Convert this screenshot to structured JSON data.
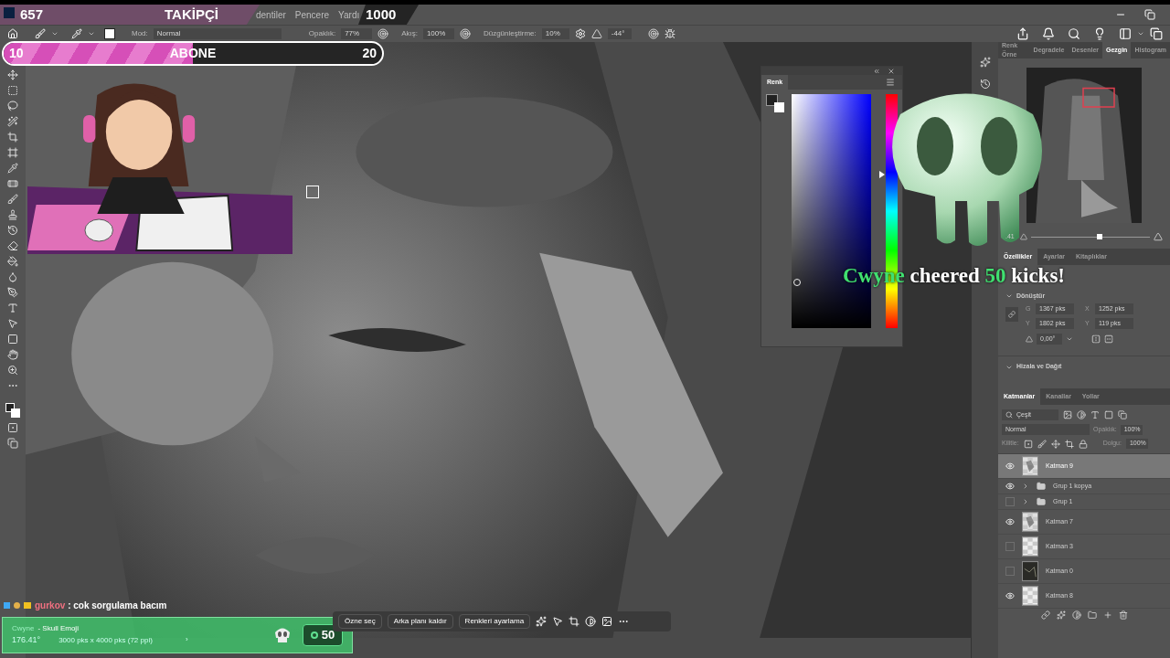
{
  "overlay_followers": {
    "count": "657",
    "label": "TAKİPÇİ",
    "goal": "1000"
  },
  "menu": [
    "dentiler",
    "Pencere",
    "Yardı"
  ],
  "options_bar": {
    "mode_label": "Mod:",
    "mode": "Normal",
    "opacity_label": "Opaklık:",
    "opacity": "77%",
    "flow_label": "Akış:",
    "flow": "100%",
    "smoothing_label": "Düzgünleştirme:",
    "smoothing": "10%",
    "angle": "-44°"
  },
  "overlay_subscribers": {
    "count": "10",
    "label": "ABONE",
    "goal": "20",
    "level": 0.5
  },
  "color_panel": {
    "tab": "Renk",
    "hue": {
      "level": 0.67
    }
  },
  "cheer": {
    "user": "Cwyne",
    "verb": "cheered",
    "amount": "50",
    "rest": "kicks!"
  },
  "top_tabs": [
    {
      "label": "Renk Örne",
      "selected": false
    },
    {
      "label": "Degradele",
      "selected": false
    },
    {
      "label": "Desenler",
      "selected": false
    },
    {
      "label": "Gezgin",
      "selected": true
    },
    {
      "label": "Histogram",
      "selected": false
    }
  ],
  "navigator": {
    "zoom_partial": ".41",
    "zoom_slider": {
      "level": 0.55
    }
  },
  "properties_tabs": [
    {
      "label": "Özellikler",
      "selected": true
    },
    {
      "label": "Ayarlar",
      "selected": false
    },
    {
      "label": "Kitaplıklar",
      "selected": false
    }
  ],
  "transform": {
    "title": "Dönüştür",
    "fields": [
      {
        "label": "G",
        "value": "1367 pks"
      },
      {
        "label": "X",
        "value": "1252 pks"
      },
      {
        "label": "Y",
        "value": "1802 pks"
      },
      {
        "label": "Y",
        "value": "119 pks"
      }
    ],
    "angle": "0,00°"
  },
  "align_section": "Hizala ve Dağıt",
  "layer_tabs": [
    {
      "label": "Katmanlar",
      "selected": true
    },
    {
      "label": "Kanallar",
      "selected": false
    },
    {
      "label": "Yollar",
      "selected": false
    }
  ],
  "layer_controls": {
    "filter": "Çeşit",
    "blend": "Normal",
    "opacity_label": "Opaklık:",
    "opacity": "100%",
    "lock_label": "Kilitle:",
    "fill_label": "Dolgu:",
    "fill": "100%"
  },
  "layers": [
    {
      "name": "Katman 9",
      "kind": "layer",
      "thumbnail": {
        "kind": "sketch"
      },
      "visible": true,
      "selected": true
    },
    {
      "name": "Grup 1 kopya",
      "kind": "group",
      "visible": true,
      "selected": false
    },
    {
      "name": "Grup 1",
      "kind": "group",
      "visible": false,
      "selected": false
    },
    {
      "name": "Katman 7",
      "kind": "layer",
      "thumbnail": {
        "kind": "sketch"
      },
      "visible": true,
      "selected": false
    },
    {
      "name": "Katman 3",
      "kind": "layer",
      "thumbnail": {
        "kind": "transparent"
      },
      "visible": false,
      "selected": false
    },
    {
      "name": "Katman 0",
      "kind": "layer",
      "thumbnail": {
        "kind": "dark"
      },
      "visible": false,
      "selected": false
    },
    {
      "name": "Katman 8",
      "kind": "layer",
      "thumbnail": {
        "kind": "transparent"
      },
      "visible": true,
      "selected": false
    }
  ],
  "chat": {
    "user": "gurkov",
    "message": ": cok sorgulama bacım"
  },
  "alert": {
    "user": "Cwyne",
    "item": "- Skull Emoji",
    "amount": "50"
  },
  "status_under": {
    "angle": "176.41°",
    "size": "3000 pks x 4000 pks (72 ppi)",
    "arrow": "›"
  },
  "task_bar": [
    "Özne seç",
    "Arka planı kaldır",
    "Renkleri ayarlama"
  ]
}
